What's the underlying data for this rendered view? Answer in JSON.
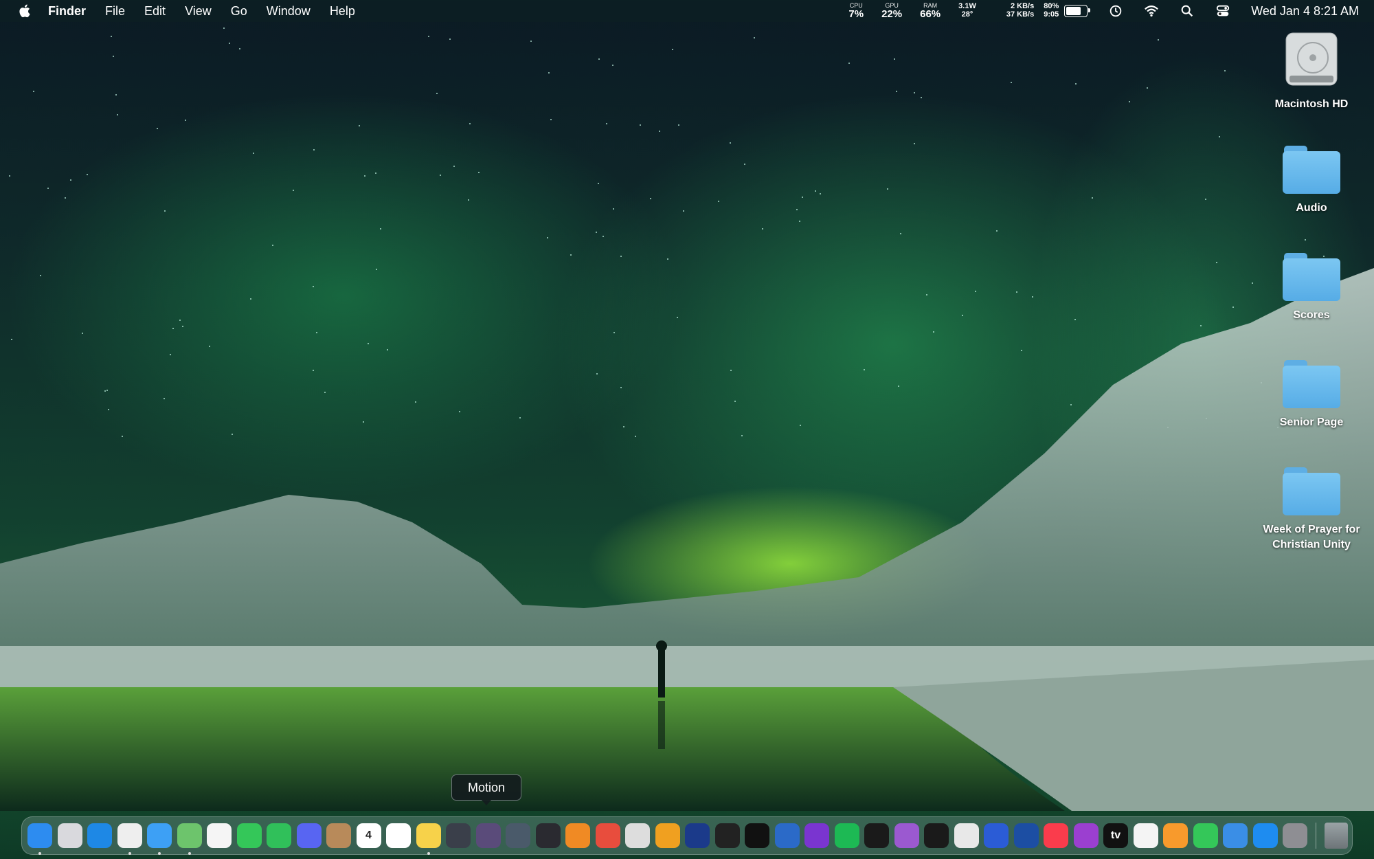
{
  "menubar": {
    "apple_icon": "apple-logo-icon",
    "app_name": "Finder",
    "menus": [
      "File",
      "Edit",
      "View",
      "Go",
      "Window",
      "Help"
    ],
    "stats": {
      "cpu_label": "CPU",
      "cpu_value": "7%",
      "gpu_label": "GPU",
      "gpu_value": "22%",
      "ram_label": "RAM",
      "ram_value": "66%",
      "power": "3.1W",
      "temp": "28°",
      "net_up": "2 KB/s",
      "net_down": "37 KB/s",
      "battery_percent": "80%",
      "battery_time": "9:05",
      "battery_level": 0.8
    },
    "icons": [
      "time-machine-icon",
      "wifi-icon",
      "spotlight-search-icon",
      "control-center-icon"
    ],
    "datetime": "Wed Jan 4  8:21 AM"
  },
  "desktop": {
    "items": [
      {
        "label": "Macintosh HD",
        "type": "drive"
      },
      {
        "label": "Audio",
        "type": "folder"
      },
      {
        "label": "Scores",
        "type": "folder"
      },
      {
        "label": "Senior Page",
        "type": "folder"
      },
      {
        "label": "Week of Prayer for Christian Unity",
        "type": "folder"
      }
    ]
  },
  "tooltip": {
    "text": "Motion"
  },
  "dock": {
    "apps": [
      {
        "name": "finder",
        "color": "#2d8cf0",
        "running": true
      },
      {
        "name": "launchpad",
        "color": "#d9d9dd",
        "running": false
      },
      {
        "name": "safari",
        "color": "#1e88e5",
        "running": false
      },
      {
        "name": "chrome",
        "color": "#eeeeee",
        "running": true
      },
      {
        "name": "mail",
        "color": "#3da0f5",
        "running": true
      },
      {
        "name": "maps",
        "color": "#6dc46c",
        "running": true
      },
      {
        "name": "photos",
        "color": "#f5f5f5",
        "running": false
      },
      {
        "name": "messages",
        "color": "#34c759",
        "running": false
      },
      {
        "name": "facetime",
        "color": "#30c05a",
        "running": false
      },
      {
        "name": "discord",
        "color": "#5865f2",
        "running": false
      },
      {
        "name": "contacts",
        "color": "#b88a5a",
        "running": false
      },
      {
        "name": "calendar",
        "color": "#ffffff",
        "running": false,
        "glyph": "4"
      },
      {
        "name": "reminders",
        "color": "#ffffff",
        "running": false
      },
      {
        "name": "notes",
        "color": "#f7d24a",
        "running": true
      },
      {
        "name": "davinci-resolve",
        "color": "#3a3f4a",
        "running": false
      },
      {
        "name": "motion",
        "color": "#5a4b7a",
        "running": false
      },
      {
        "name": "compressor",
        "color": "#4a5a6a",
        "running": false
      },
      {
        "name": "obs",
        "color": "#2a2a30",
        "running": false
      },
      {
        "name": "blender",
        "color": "#f08a24",
        "running": false
      },
      {
        "name": "aperture",
        "color": "#e84d3d",
        "running": false
      },
      {
        "name": "disk-utility",
        "color": "#ddd",
        "running": false
      },
      {
        "name": "photo-booth",
        "color": "#f0a020",
        "running": false
      },
      {
        "name": "podcast-app",
        "color": "#1b3a8a",
        "running": false
      },
      {
        "name": "vectorworks",
        "color": "#222",
        "running": false
      },
      {
        "name": "c-app",
        "color": "#111",
        "running": false
      },
      {
        "name": "sketch-app",
        "color": "#2b6ac8",
        "running": false
      },
      {
        "name": "musescore",
        "color": "#7a35d0",
        "running": false
      },
      {
        "name": "spotify",
        "color": "#1db954",
        "running": false
      },
      {
        "name": "activity-monitor",
        "color": "#1a1a1a",
        "running": false
      },
      {
        "name": "system-preferences-purple",
        "color": "#9b59d0",
        "running": false
      },
      {
        "name": "terminal",
        "color": "#1a1a1a",
        "running": false
      },
      {
        "name": "preview",
        "color": "#e8e8e8",
        "running": false
      },
      {
        "name": "screens",
        "color": "#2b5cd6",
        "running": false
      },
      {
        "name": "bitwarden",
        "color": "#1c4ea3",
        "running": false
      },
      {
        "name": "music",
        "color": "#fa3c4c",
        "running": false
      },
      {
        "name": "podcasts",
        "color": "#9b3fd0",
        "running": false
      },
      {
        "name": "apple-tv",
        "color": "#111",
        "running": false,
        "glyph": "tv"
      },
      {
        "name": "news",
        "color": "#f4f4f4",
        "running": false
      },
      {
        "name": "pages",
        "color": "#f89a2c",
        "running": false
      },
      {
        "name": "numbers",
        "color": "#34c759",
        "running": false
      },
      {
        "name": "keynote",
        "color": "#3a8ee6",
        "running": false
      },
      {
        "name": "app-store",
        "color": "#1e8cf0",
        "running": false
      },
      {
        "name": "system-settings",
        "color": "#8e8e93",
        "running": false
      }
    ],
    "trash": "trash-icon"
  }
}
